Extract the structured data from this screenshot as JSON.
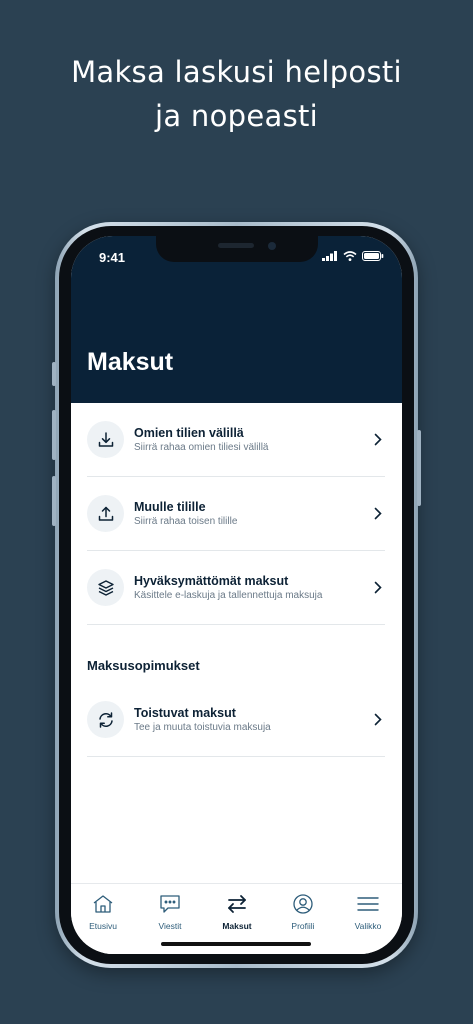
{
  "promo": {
    "line1": "Maksa laskusi helposti",
    "line2": "ja nopeasti"
  },
  "status_bar": {
    "time": "9:41",
    "icons": [
      "signal-icon",
      "wifi-icon",
      "battery-icon"
    ]
  },
  "header": {
    "title": "Maksut"
  },
  "items": [
    {
      "title": "Omien tilien välillä",
      "subtitle": "Siirrä rahaa omien tiliesi välillä",
      "icon": "download-icon"
    },
    {
      "title": "Muulle tilille",
      "subtitle": "Siirrä rahaa toisen tilille",
      "icon": "upload-icon"
    },
    {
      "title": "Hyväksymättömät maksut",
      "subtitle": "Käsittele e-laskuja ja tallennettuja maksuja",
      "icon": "layers-icon"
    }
  ],
  "section": {
    "title": "Maksusopimukset"
  },
  "agreements": [
    {
      "title": "Toistuvat maksut",
      "subtitle": "Tee ja muuta toistuvia maksuja",
      "icon": "refresh-icon"
    }
  ],
  "tabs": [
    {
      "label": "Etusivu",
      "icon": "home-icon"
    },
    {
      "label": "Viestit",
      "icon": "message-icon"
    },
    {
      "label": "Maksut",
      "icon": "transfer-arrows-icon",
      "active": true
    },
    {
      "label": "Profiili",
      "icon": "profile-icon"
    },
    {
      "label": "Valikko",
      "icon": "menu-icon"
    }
  ],
  "colors": {
    "background": "#2b4152",
    "header": "#0a2238",
    "text_dark": "#0d2235",
    "tab_text": "#2e5d7a"
  }
}
